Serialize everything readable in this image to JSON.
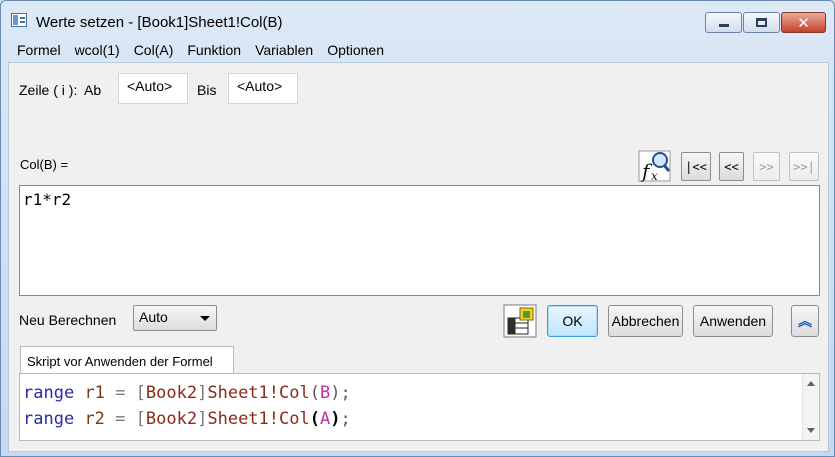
{
  "window": {
    "title": "Werte setzen - [Book1]Sheet1!Col(B)"
  },
  "menu": [
    "Formel",
    "wcol(1)",
    "Col(A)",
    "Funktion",
    "Variablen",
    "Optionen"
  ],
  "row_range": {
    "label": "Zeile ( i ):",
    "from_label": "Ab",
    "from_value": "<Auto>",
    "to_label": "Bis",
    "to_value": "<Auto>"
  },
  "formula": {
    "label": "Col(B) =",
    "expression": "r1*r2"
  },
  "nav_buttons": [
    "|<<",
    "<<",
    ">>",
    ">>|"
  ],
  "recalculate": {
    "label": "Neu Berechnen",
    "value": "Auto"
  },
  "buttons": {
    "ok": "OK",
    "cancel": "Abbrechen",
    "apply": "Anwenden"
  },
  "script_tab": {
    "label": "Skript vor Anwenden der Formel"
  },
  "script_lines": [
    {
      "keyword": "range",
      "var": "r1",
      "op": "=",
      "book": "Book2",
      "sheet": "Sheet1!Col",
      "col": "B"
    },
    {
      "keyword": "range",
      "var": "r2",
      "op": "=",
      "book": "Book2",
      "sheet": "Sheet1!Col",
      "col": "A"
    }
  ]
}
